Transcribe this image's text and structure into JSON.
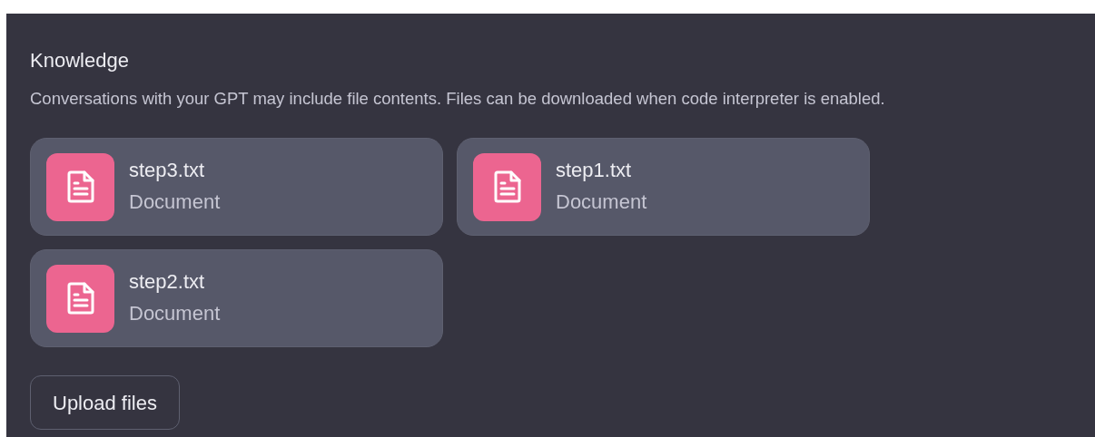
{
  "section": {
    "title": "Knowledge",
    "description": "Conversations with your GPT may include file contents. Files can be downloaded when code interpreter is enabled."
  },
  "files": [
    {
      "name": "step3.txt",
      "type": "Document"
    },
    {
      "name": "step1.txt",
      "type": "Document"
    },
    {
      "name": "step2.txt",
      "type": "Document"
    }
  ],
  "upload_button": "Upload files"
}
